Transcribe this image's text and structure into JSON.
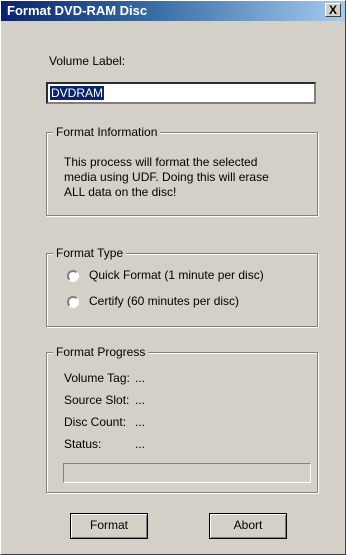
{
  "window": {
    "title": "Format DVD-RAM Disc",
    "close_label": "X"
  },
  "volume": {
    "label": "Volume Label:",
    "value": "DVDRAM"
  },
  "format_info": {
    "legend": "Format Information",
    "lines": [
      "This process will format the selected",
      "media using UDF.  Doing this will erase",
      "ALL data on the disc!"
    ]
  },
  "format_type": {
    "legend": "Format Type",
    "options": [
      {
        "label": "Quick Format (1 minute per disc)",
        "selected": false
      },
      {
        "label": "Certify (60 minutes per disc)",
        "selected": false
      }
    ]
  },
  "progress": {
    "legend": "Format Progress",
    "rows": [
      {
        "label": "Volume Tag:",
        "value": "..."
      },
      {
        "label": "Source Slot:",
        "value": "..."
      },
      {
        "label": "Disc Count:",
        "value": "..."
      },
      {
        "label": "Status:",
        "value": "..."
      }
    ],
    "percent": 0
  },
  "buttons": {
    "format": "Format",
    "abort": "Abort"
  }
}
